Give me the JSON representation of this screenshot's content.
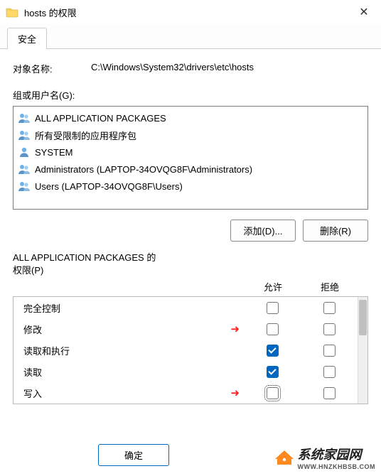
{
  "titlebar": {
    "title": "hosts 的权限"
  },
  "tabs": {
    "security": "安全"
  },
  "object": {
    "label": "对象名称:",
    "value": "C:\\Windows\\System32\\drivers\\etc\\hosts"
  },
  "groups_label": "组或用户名(G):",
  "principals": [
    {
      "name": "ALL APPLICATION PACKAGES",
      "icon": "users"
    },
    {
      "name": "所有受限制的应用程序包",
      "icon": "users"
    },
    {
      "name": "SYSTEM",
      "icon": "user"
    },
    {
      "name": "Administrators (LAPTOP-34OVQG8F\\Administrators)",
      "icon": "users"
    },
    {
      "name": "Users (LAPTOP-34OVQG8F\\Users)",
      "icon": "users"
    }
  ],
  "buttons": {
    "add": "添加(D)...",
    "remove": "删除(R)",
    "ok": "确定"
  },
  "perm_title_a": "ALL APPLICATION PACKAGES 的",
  "perm_title_b": "权限(P)",
  "columns": {
    "allow": "允许",
    "deny": "拒绝"
  },
  "permissions": [
    {
      "name": "完全控制",
      "allow": false,
      "deny": false,
      "arrow": false,
      "dotted": false
    },
    {
      "name": "修改",
      "allow": false,
      "deny": false,
      "arrow": true,
      "dotted": false
    },
    {
      "name": "读取和执行",
      "allow": true,
      "deny": false,
      "arrow": false,
      "dotted": false
    },
    {
      "name": "读取",
      "allow": true,
      "deny": false,
      "arrow": false,
      "dotted": false
    },
    {
      "name": "写入",
      "allow": false,
      "deny": false,
      "arrow": true,
      "dotted": true
    }
  ],
  "watermark": {
    "text": "系统家园网",
    "sub": "WWW.HNZKHBSB.COM"
  }
}
